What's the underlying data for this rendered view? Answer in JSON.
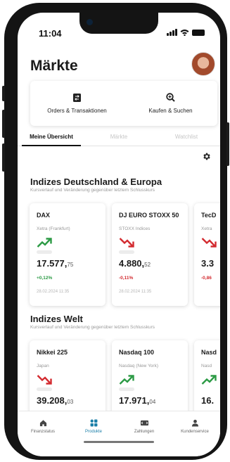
{
  "status": {
    "time": "11:04"
  },
  "header": {
    "title": "Märkte"
  },
  "actions": {
    "orders_label": "Orders & Transaktionen",
    "buy_search_label": "Kaufen & Suchen"
  },
  "tabs": [
    {
      "label": "Meine Übersicht",
      "active": true
    },
    {
      "label": "Märkte",
      "active": false
    },
    {
      "label": "Watchlist",
      "active": false
    }
  ],
  "sections": [
    {
      "title": "Indizes Deutschland & Europa",
      "subtitle": "Kursverlauf und Veränderung gegenüber letztem Schlusskurs",
      "cards": [
        {
          "name": "DAX",
          "exchange": "Xetra (Frankfurt)",
          "trend": "up",
          "price_main": "17.577,",
          "price_dec": "75",
          "change": "+0,12%",
          "date": "28.02.2024 11:35"
        },
        {
          "name": "DJ EURO STOXX 50",
          "exchange": "STOXX Indices",
          "trend": "down",
          "price_main": "4.880,",
          "price_dec": "52",
          "change": "-0,11%",
          "date": "28.02.2024 11:35"
        },
        {
          "name": "TecD",
          "exchange": "Xetra",
          "trend": "down",
          "price_main": "3.3",
          "price_dec": "",
          "change": "-0,86",
          "date": ""
        }
      ]
    },
    {
      "title": "Indizes Welt",
      "subtitle": "Kursverlauf und Veränderung gegenüber letztem Schlusskurs",
      "cards": [
        {
          "name": "Nikkei 225",
          "exchange": "Japan",
          "trend": "down",
          "price_main": "39.208,",
          "price_dec": "03",
          "change": "",
          "date": ""
        },
        {
          "name": "Nasdaq 100",
          "exchange": "Nasdaq (New York)",
          "trend": "up",
          "price_main": "17.971,",
          "price_dec": "04",
          "change": "",
          "date": ""
        },
        {
          "name": "Nasd",
          "exchange": "Nasd",
          "trend": "up",
          "price_main": "16.",
          "price_dec": "",
          "change": "",
          "date": ""
        }
      ]
    }
  ],
  "nav": [
    {
      "label": "Finanzstatus",
      "icon": "home-icon",
      "active": false
    },
    {
      "label": "Produkte",
      "icon": "products-icon",
      "active": true
    },
    {
      "label": "Zahlungen",
      "icon": "payments-icon",
      "active": false
    },
    {
      "label": "Kundenservice",
      "icon": "customer-service-icon",
      "active": false
    }
  ],
  "colors": {
    "up": "#2b9a44",
    "down": "#d32a2f",
    "accent": "#1b7fa8"
  }
}
